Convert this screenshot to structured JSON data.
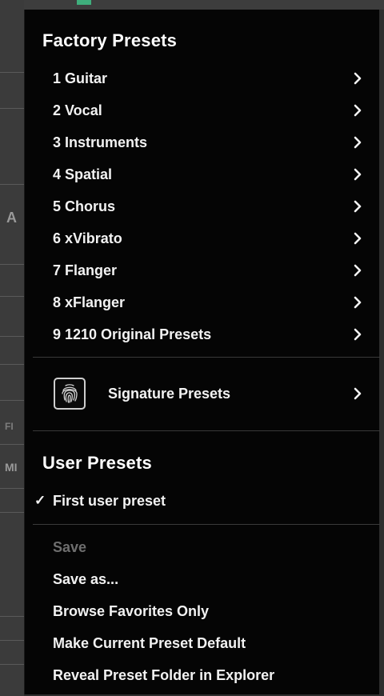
{
  "factory": {
    "title": "Factory Presets",
    "items": [
      {
        "label": "1 Guitar"
      },
      {
        "label": "2 Vocal"
      },
      {
        "label": "3 Instruments"
      },
      {
        "label": "4 Spatial"
      },
      {
        "label": "5 Chorus"
      },
      {
        "label": "6 xVibrato"
      },
      {
        "label": "7 Flanger"
      },
      {
        "label": "8 xFlanger"
      },
      {
        "label": "9 1210 Original Presets"
      }
    ]
  },
  "signature": {
    "label": "Signature Presets",
    "icon": "fingerprint-icon"
  },
  "user": {
    "title": "User Presets",
    "current_preset": "First user preset",
    "check_mark": "✓"
  },
  "actions": {
    "save": "Save",
    "save_as": "Save as...",
    "browse_favorites": "Browse Favorites Only",
    "make_default": "Make Current Preset Default",
    "reveal_folder": "Reveal Preset Folder in Explorer"
  },
  "host": {
    "left_letters": [
      "A",
      "FI",
      "MI"
    ]
  },
  "colors": {
    "menu_bg": "#050505",
    "text": "#f2f2f2",
    "disabled_text": "#6e6e6e",
    "divider": "#3a3a3a",
    "accent": "#3fae7c"
  }
}
